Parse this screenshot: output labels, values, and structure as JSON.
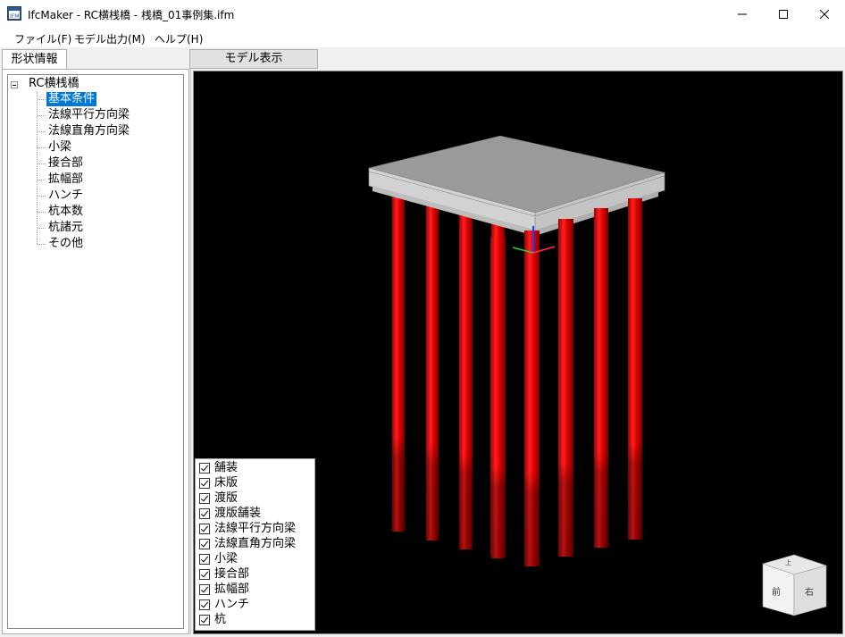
{
  "window": {
    "title": "IfcMaker - RC横桟橋 - 桟橋_01事例集.ifm",
    "icon": "ifc-app-icon",
    "controls": [
      "minimize",
      "maximize",
      "close"
    ]
  },
  "menu": [
    "ファイル(F)",
    "モデル出力(M)",
    "ヘルプ(H)"
  ],
  "tabs": {
    "left": "形状情報",
    "right": "モデル表示"
  },
  "tree": {
    "root": "RC横桟橋",
    "selected_index": 0,
    "items": [
      "基本条件",
      "法線平行方向梁",
      "法線直角方向梁",
      "小梁",
      "接合部",
      "拡幅部",
      "ハンチ",
      "杭本数",
      "杭諸元",
      "その他"
    ]
  },
  "layers": [
    {
      "label": "舗装",
      "checked": true
    },
    {
      "label": "床版",
      "checked": true
    },
    {
      "label": "渡版",
      "checked": true
    },
    {
      "label": "渡版舗装",
      "checked": true
    },
    {
      "label": "法線平行方向梁",
      "checked": true
    },
    {
      "label": "法線直角方向梁",
      "checked": true
    },
    {
      "label": "小梁",
      "checked": true
    },
    {
      "label": "接合部",
      "checked": true
    },
    {
      "label": "拡幅部",
      "checked": true
    },
    {
      "label": "ハンチ",
      "checked": true
    },
    {
      "label": "杭",
      "checked": true
    }
  ],
  "view_cube": {
    "front": "前",
    "right": "右",
    "top": "上"
  },
  "colors": {
    "viewport_bg": "#000000",
    "pile": "#e00000",
    "deck_top": "#9a9a9a",
    "deck_side": "#cfcfcf",
    "selection": "#0078d7"
  }
}
